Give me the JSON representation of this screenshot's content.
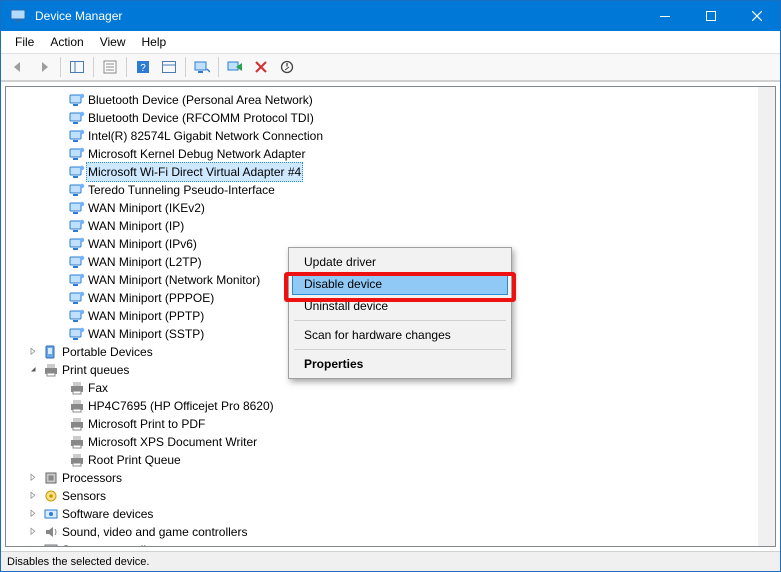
{
  "window": {
    "title": "Device Manager"
  },
  "menu": {
    "file": "File",
    "action": "Action",
    "view": "View",
    "help": "Help"
  },
  "network_devices": [
    "Bluetooth Device (Personal Area Network)",
    "Bluetooth Device (RFCOMM Protocol TDI)",
    "Intel(R) 82574L Gigabit Network Connection",
    "Microsoft Kernel Debug Network Adapter",
    "Microsoft Wi-Fi Direct Virtual Adapter #4",
    "Teredo Tunneling Pseudo-Interface",
    "WAN Miniport (IKEv2)",
    "WAN Miniport (IP)",
    "WAN Miniport (IPv6)",
    "WAN Miniport (L2TP)",
    "WAN Miniport (Network Monitor)",
    "WAN Miniport (PPPOE)",
    "WAN Miniport (PPTP)",
    "WAN Miniport (SSTP)"
  ],
  "categories": [
    {
      "name": "Portable Devices",
      "icon": "portable"
    },
    {
      "name": "Print queues",
      "icon": "printer",
      "expanded": true
    },
    {
      "name": "Processors",
      "icon": "cpu"
    },
    {
      "name": "Sensors",
      "icon": "sensor"
    },
    {
      "name": "Software devices",
      "icon": "software"
    },
    {
      "name": "Sound, video and game controllers",
      "icon": "sound"
    },
    {
      "name": "Storage controllers",
      "icon": "storage"
    }
  ],
  "print_queues": [
    "Fax",
    "HP4C7695 (HP Officejet Pro 8620)",
    "Microsoft Print to PDF",
    "Microsoft XPS Document Writer",
    "Root Print Queue"
  ],
  "context_menu": {
    "update": "Update driver",
    "disable": "Disable device",
    "uninstall": "Uninstall device",
    "scan": "Scan for hardware changes",
    "properties": "Properties"
  },
  "status": "Disables the selected device."
}
